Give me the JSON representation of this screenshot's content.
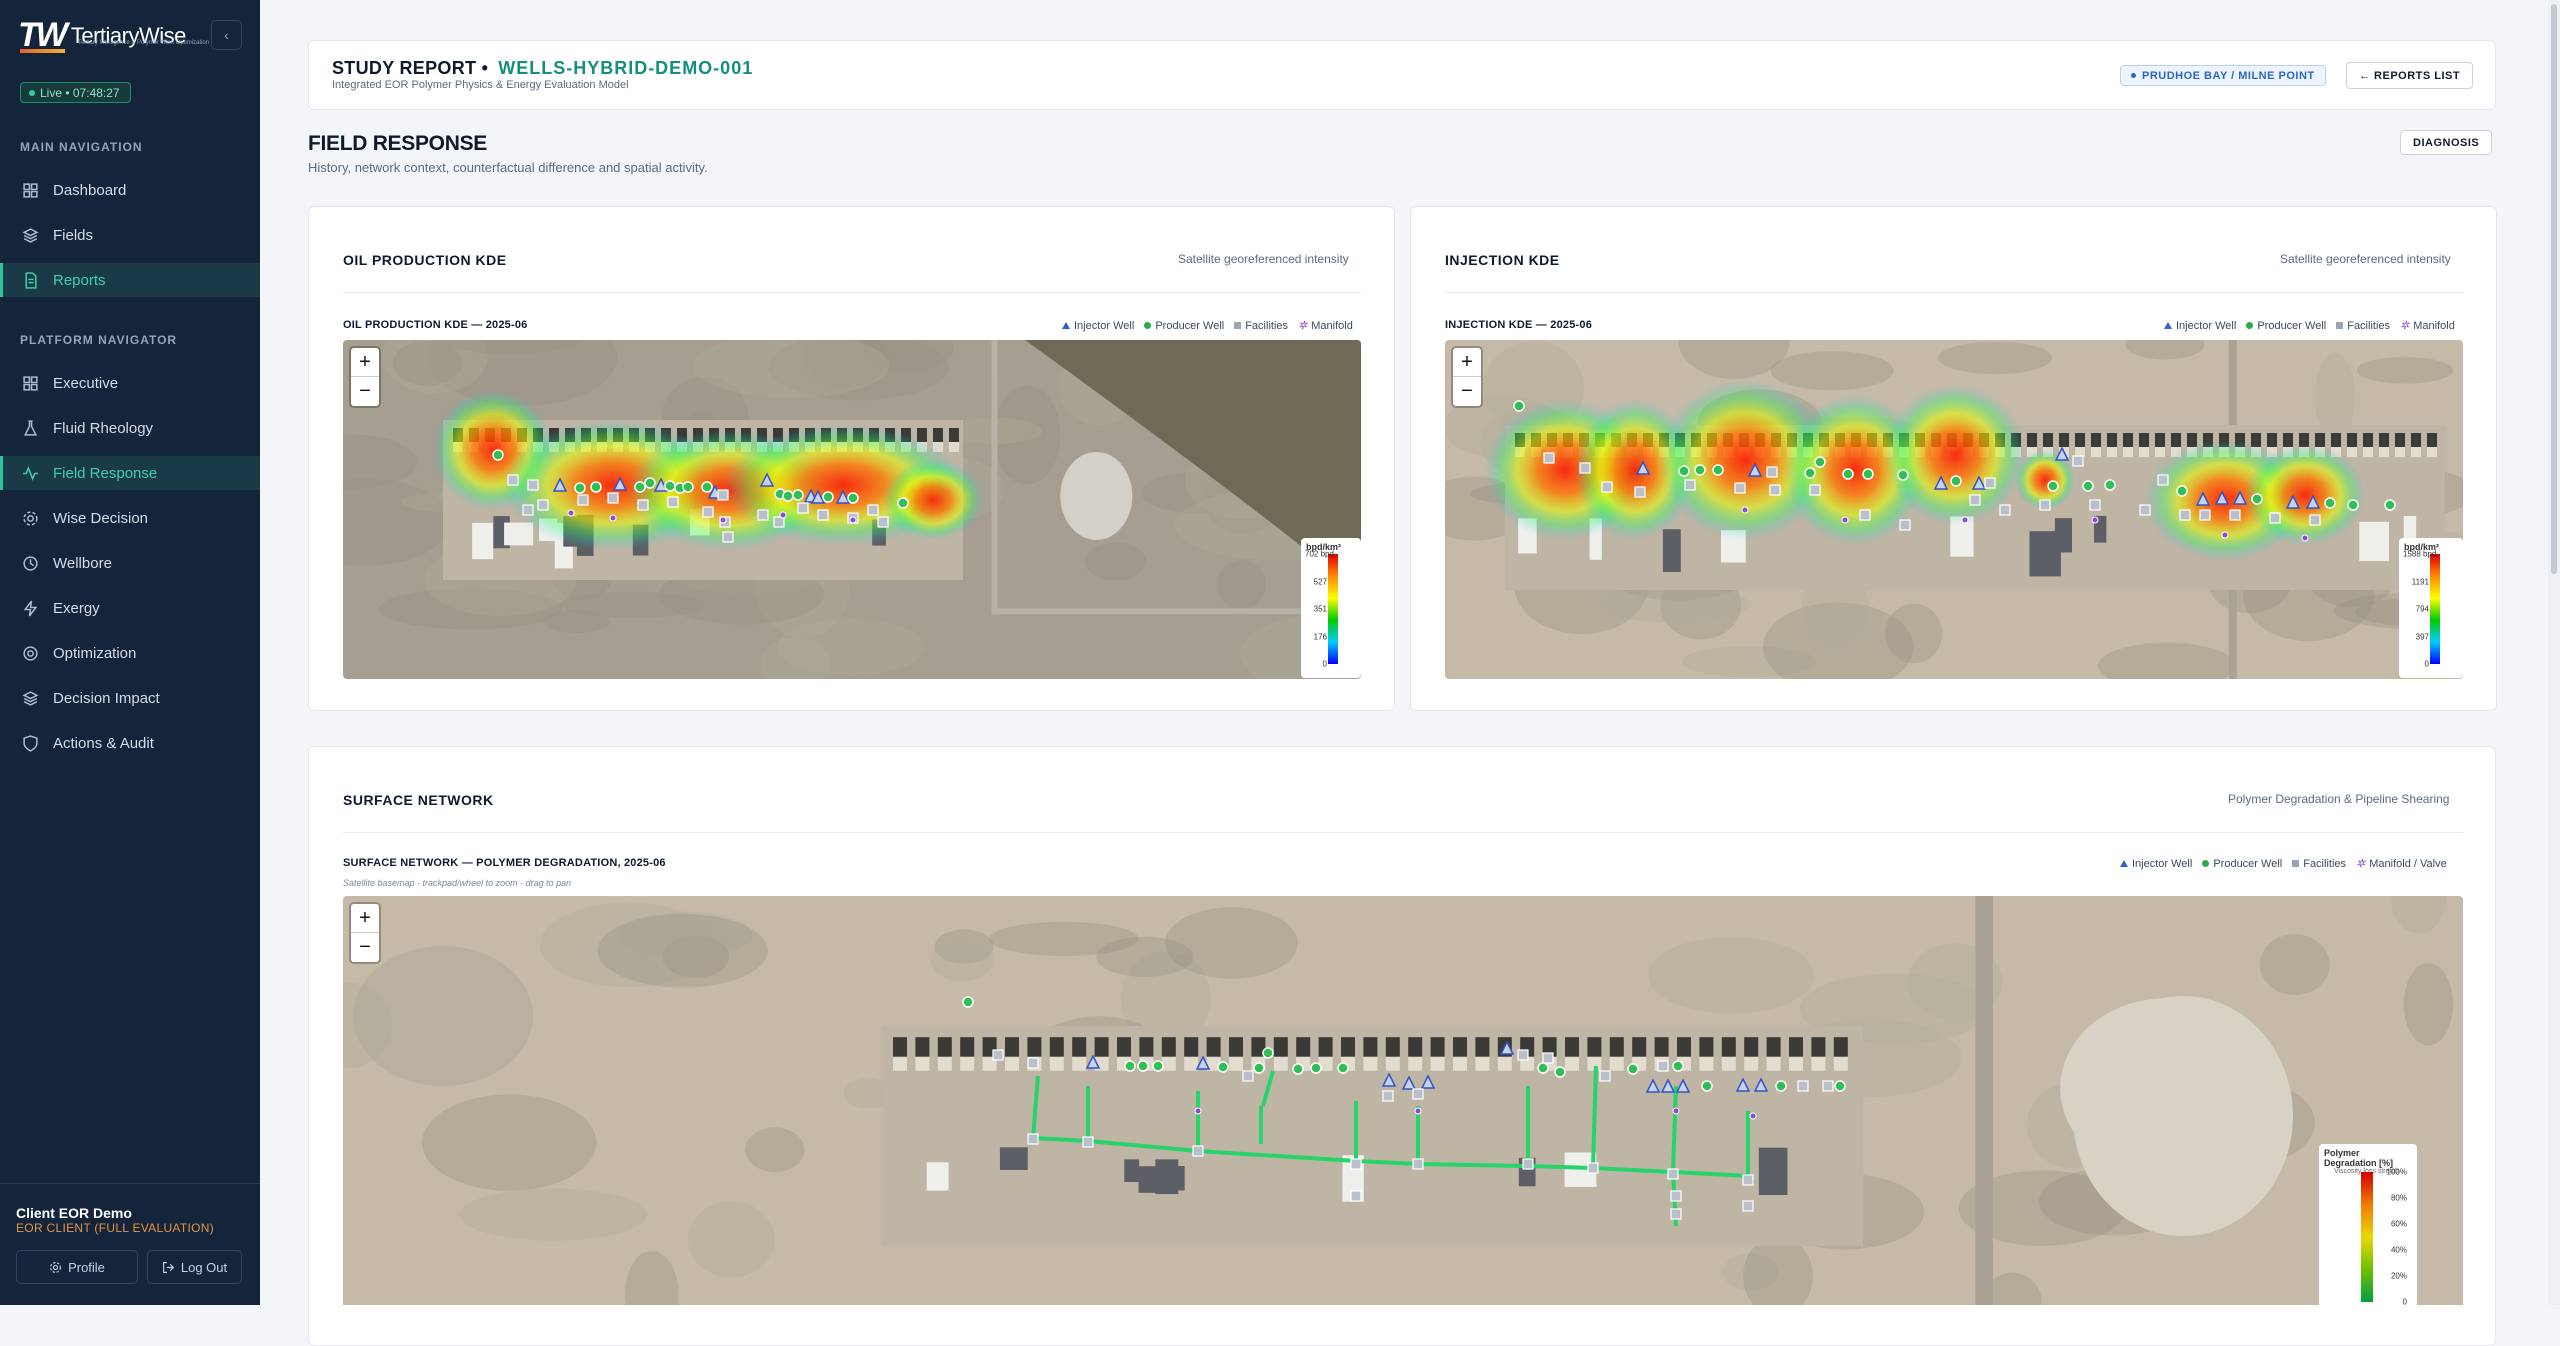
{
  "sidebar": {
    "brand": "TertiaryWise",
    "brand_mark": "TW",
    "brand_tagline": "Tertiary Intelligence & Polymer Wise Optimization",
    "live": "Live • 07:48:27",
    "main_heading": "MAIN NAVIGATION",
    "main_items": [
      {
        "label": "Dashboard",
        "icon": "dashboard-icon"
      },
      {
        "label": "Fields",
        "icon": "layers-icon"
      },
      {
        "label": "Reports",
        "icon": "document-icon",
        "active": true
      }
    ],
    "platform_heading": "PLATFORM NAVIGATOR",
    "platform_items": [
      {
        "label": "Executive",
        "icon": "dashboard-icon"
      },
      {
        "label": "Fluid Rheology",
        "icon": "flask-icon"
      },
      {
        "label": "Field Response",
        "icon": "activity-icon",
        "active": true
      },
      {
        "label": "Wise Decision",
        "icon": "gear-icon"
      },
      {
        "label": "Wellbore",
        "icon": "clock-icon"
      },
      {
        "label": "Exergy",
        "icon": "bolt-icon"
      },
      {
        "label": "Optimization",
        "icon": "target-icon"
      },
      {
        "label": "Decision Impact",
        "icon": "layers-icon"
      },
      {
        "label": "Actions & Audit",
        "icon": "shield-icon"
      }
    ],
    "user_name": "Client EOR Demo",
    "user_role": "EOR CLIENT (FULL EVALUATION)",
    "profile_label": "Profile",
    "logout_label": "Log Out"
  },
  "header": {
    "title": "STUDY REPORT •",
    "study_id": "WELLS-HYBRID-DEMO-001",
    "subtitle": "Integrated EOR Polymer Physics & Energy Evaluation Model",
    "location": "PRUDHOE BAY / MILNE POINT",
    "reports_list": "← REPORTS LIST"
  },
  "section": {
    "title": "FIELD RESPONSE",
    "subtitle": "History, network context, counterfactual difference and spatial activity.",
    "diagnosis": "DIAGNOSIS"
  },
  "oil_card": {
    "title": "OIL PRODUCTION KDE",
    "right": "Satellite georeferenced intensity",
    "map_title": "OIL PRODUCTION KDE — 2025-06",
    "legend_unit": "bpd/km²",
    "legend_ticks": [
      "702 bpd",
      "527",
      "351",
      "176",
      "0"
    ]
  },
  "inj_card": {
    "title": "INJECTION KDE",
    "right": "Satellite georeferenced intensity",
    "map_title": "INJECTION KDE — 2025-06",
    "legend_unit": "bpd/km²",
    "legend_ticks": [
      "1588 bpd",
      "1191",
      "794",
      "397",
      "0"
    ]
  },
  "legend": {
    "injector": "Injector Well",
    "producer": "Producer Well",
    "facilities": "Facilities",
    "manifold": "Manifold",
    "manifold_valve": "Manifold / Valve"
  },
  "network_card": {
    "title": "SURFACE NETWORK",
    "right": "Polymer Degradation & Pipeline Shearing",
    "map_title": "SURFACE NETWORK — POLYMER DEGRADATION, 2025-06",
    "note": "Satellite basemap · trackpad/wheel to zoom · drag to pan",
    "legend_title": "Polymer Degradation [%]",
    "legend_sub": "Viscosity loss stretch",
    "legend_ticks": [
      "100%",
      "80%",
      "60%",
      "40%",
      "20%",
      "0"
    ]
  },
  "zoom": {
    "in": "+",
    "out": "−"
  }
}
